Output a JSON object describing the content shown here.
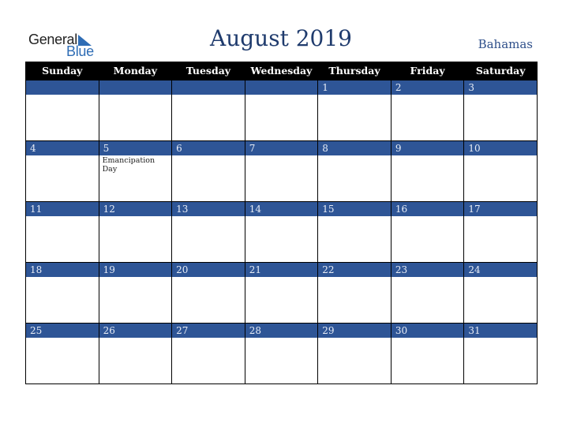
{
  "logo": {
    "word1": "General",
    "word2": "Blue"
  },
  "header": {
    "title": "August 2019",
    "country": "Bahamas"
  },
  "weekdays": [
    "Sunday",
    "Monday",
    "Tuesday",
    "Wednesday",
    "Thursday",
    "Friday",
    "Saturday"
  ],
  "weeks": [
    [
      "",
      "",
      "",
      "",
      "1",
      "2",
      "3"
    ],
    [
      "4",
      "5",
      "6",
      "7",
      "8",
      "9",
      "10"
    ],
    [
      "11",
      "12",
      "13",
      "14",
      "15",
      "16",
      "17"
    ],
    [
      "18",
      "19",
      "20",
      "21",
      "22",
      "23",
      "24"
    ],
    [
      "25",
      "26",
      "27",
      "28",
      "29",
      "30",
      "31"
    ]
  ],
  "holidays": {
    "5": "Emancipation Day"
  },
  "colors": {
    "header_bg": "#000000",
    "date_bar": "#2e5596",
    "title": "#1f3b6d",
    "brand_blue": "#2f6db5"
  }
}
